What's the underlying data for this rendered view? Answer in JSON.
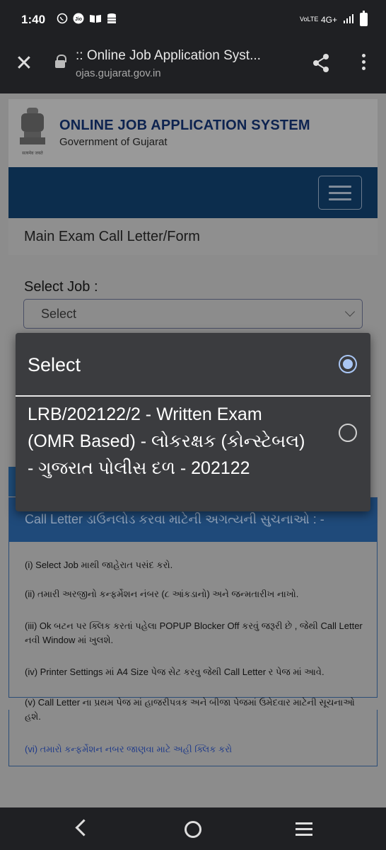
{
  "status_bar": {
    "time": "1:40",
    "left_icons": [
      "whatsapp-icon",
      "jio-icon",
      "book-icon",
      "database-icon"
    ],
    "network": "4G+",
    "volte": "VoLTE"
  },
  "browser": {
    "page_title": ":: Online Job Application Syst...",
    "url": "ojas.gujarat.gov.in"
  },
  "header": {
    "emblem_caption": "सत्यमेव जयते",
    "title": "ONLINE JOB APPLICATION SYSTEM",
    "subtitle": "Government of Gujarat"
  },
  "main": {
    "section_title": "Main Exam Call Letter/Form",
    "select_job_label": "Select Job :",
    "select_value": "Select"
  },
  "dropdown": {
    "options": [
      {
        "label": "Select",
        "selected": true
      },
      {
        "label": "LRB/202122/2 - Written Exam (OMR Based) - લોકરક્ષક (કોન્સ્ટેબલ) - ગુજરાત પોલીસ દળ - 202122",
        "selected": false
      }
    ]
  },
  "instructions": {
    "heading": "Call Letter ડાઉનલોડ કરવા માટેની અગત્યની સુચનાઓ : -",
    "items": [
      "(i) Select Job માથી જાહેરાત પસંદ કરો.",
      "(ii) તમારી અરજીનો કન્ફર્મેશન નંબર (૮ આંકડાનો) અને જન્મતારીખ નાખો.",
      "(iii) Ok બટન પર ક્લિક કરતાં પહેલા POPUP Blocker Off કરવું જરૂરી છે , જેથી Call Letter નવી Window માં ખુલશે.",
      "(iv) Printer Settings માં A4 Size પેજ સેટ કરવુ જેથી Call Letter ર પેજ માં આવે.",
      "(v) Call Letter ના પ્રથમ પેજ માં હાજરીપત્રક અને બીજા પેજમાં ઉમેદવાર માટેની સૂચનાઓ હશે.",
      "(vi) તમારો કન્ફર્મેશન નબર જાણવા માટે અહી ક્લિક કરો"
    ]
  }
}
